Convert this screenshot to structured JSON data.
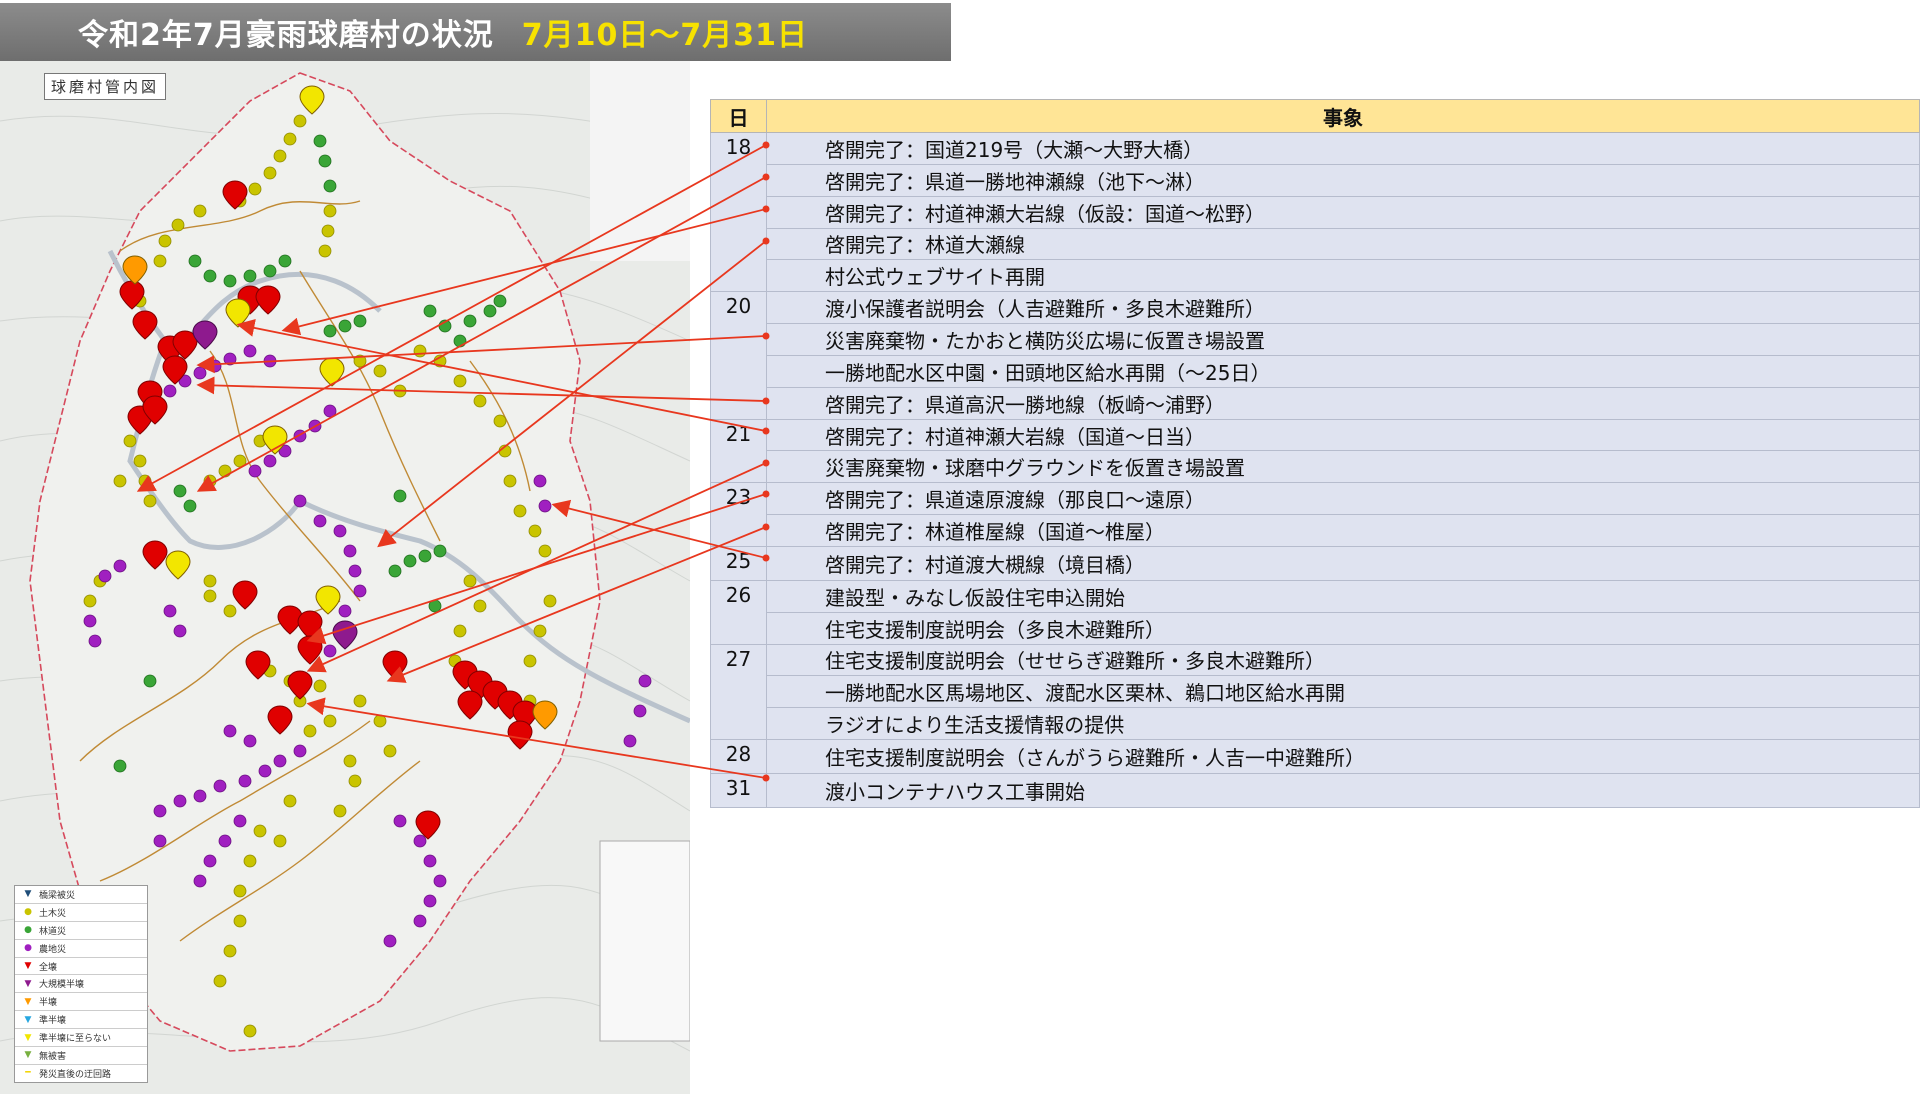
{
  "title": {
    "main": "令和2年7月豪雨球磨村の状況",
    "period": "7月10日～7月31日"
  },
  "map": {
    "label": "球磨村管内図",
    "legend": [
      {
        "label": "橋梁被災",
        "color": "#1f4e79",
        "symbol": "▼"
      },
      {
        "label": "土木災",
        "color": "#c9c400",
        "symbol": "●"
      },
      {
        "label": "林道災",
        "color": "#3aa537",
        "symbol": "●"
      },
      {
        "label": "農地災",
        "color": "#a020c0",
        "symbol": "●"
      },
      {
        "label": "全壊",
        "color": "#e00000",
        "symbol": "▼"
      },
      {
        "label": "大規模半壊",
        "color": "#8e1a8e",
        "symbol": "▼"
      },
      {
        "label": "半壊",
        "color": "#ff9a00",
        "symbol": "▼"
      },
      {
        "label": "準半壊",
        "color": "#27a7e0",
        "symbol": "▼"
      },
      {
        "label": "準半壊に至らない",
        "color": "#f2e600",
        "symbol": "▼"
      },
      {
        "label": "無被害",
        "color": "#78b040",
        "symbol": "▼"
      },
      {
        "label": "発災直後の迂回路",
        "color": "#f2d400",
        "symbol": "━"
      }
    ]
  },
  "table": {
    "headers": {
      "day": "日",
      "event": "事象"
    },
    "rows": [
      {
        "day": "18",
        "event": "啓開完了：国道219号（大瀬～大野大橋）"
      },
      {
        "day": "",
        "event": "啓開完了：県道一勝地神瀬線（池下～淋）"
      },
      {
        "day": "",
        "event": "啓開完了：村道神瀬大岩線（仮設：国道～松野）"
      },
      {
        "day": "",
        "event": "啓開完了：林道大瀬線"
      },
      {
        "day": "",
        "event": "村公式ウェブサイト再開"
      },
      {
        "day": "20",
        "event": "渡小保護者説明会（人吉避難所・多良木避難所）"
      },
      {
        "day": "",
        "event": "災害廃棄物・たかおと横防災広場に仮置き場設置"
      },
      {
        "day": "",
        "event": "一勝地配水区中園・田頭地区給水再開（～25日）"
      },
      {
        "day": "",
        "event": "啓開完了：県道高沢一勝地線（板崎～浦野）"
      },
      {
        "day": "21",
        "event": "啓開完了：村道神瀬大岩線（国道～日当）"
      },
      {
        "day": "",
        "event": "災害廃棄物・球磨中グラウンドを仮置き場設置"
      },
      {
        "day": "23",
        "event": "啓開完了：県道遠原渡線（那良口～遠原）"
      },
      {
        "day": "",
        "event": "啓開完了：林道椎屋線（国道～椎屋）"
      },
      {
        "day": "25",
        "event": "啓開完了：村道渡大槻線（境目橋）"
      },
      {
        "day": "26",
        "event": "建設型・みなし仮設住宅申込開始"
      },
      {
        "day": "",
        "event": "住宅支援制度説明会（多良木避難所）"
      },
      {
        "day": "27",
        "event": "住宅支援制度説明会（せせらぎ避難所・多良木避難所）"
      },
      {
        "day": "",
        "event": "一勝地配水区馬場地区、渡配水区栗林、鵜口地区給水再開"
      },
      {
        "day": "",
        "event": "ラジオにより生活支援情報の提供"
      },
      {
        "day": "28",
        "event": "住宅支援制度説明会（さんがうら避難所・人吉一中避難所）"
      },
      {
        "day": "31",
        "event": "渡小コンテナハウス工事開始"
      }
    ]
  },
  "colors": {
    "title_bg": "#7a7a7a",
    "title_text": "#ffffff",
    "period_text": "#f7e200",
    "header_bg": "#ffe596",
    "row_bg": "#dfe3f0",
    "arrow": "#e8371e"
  }
}
